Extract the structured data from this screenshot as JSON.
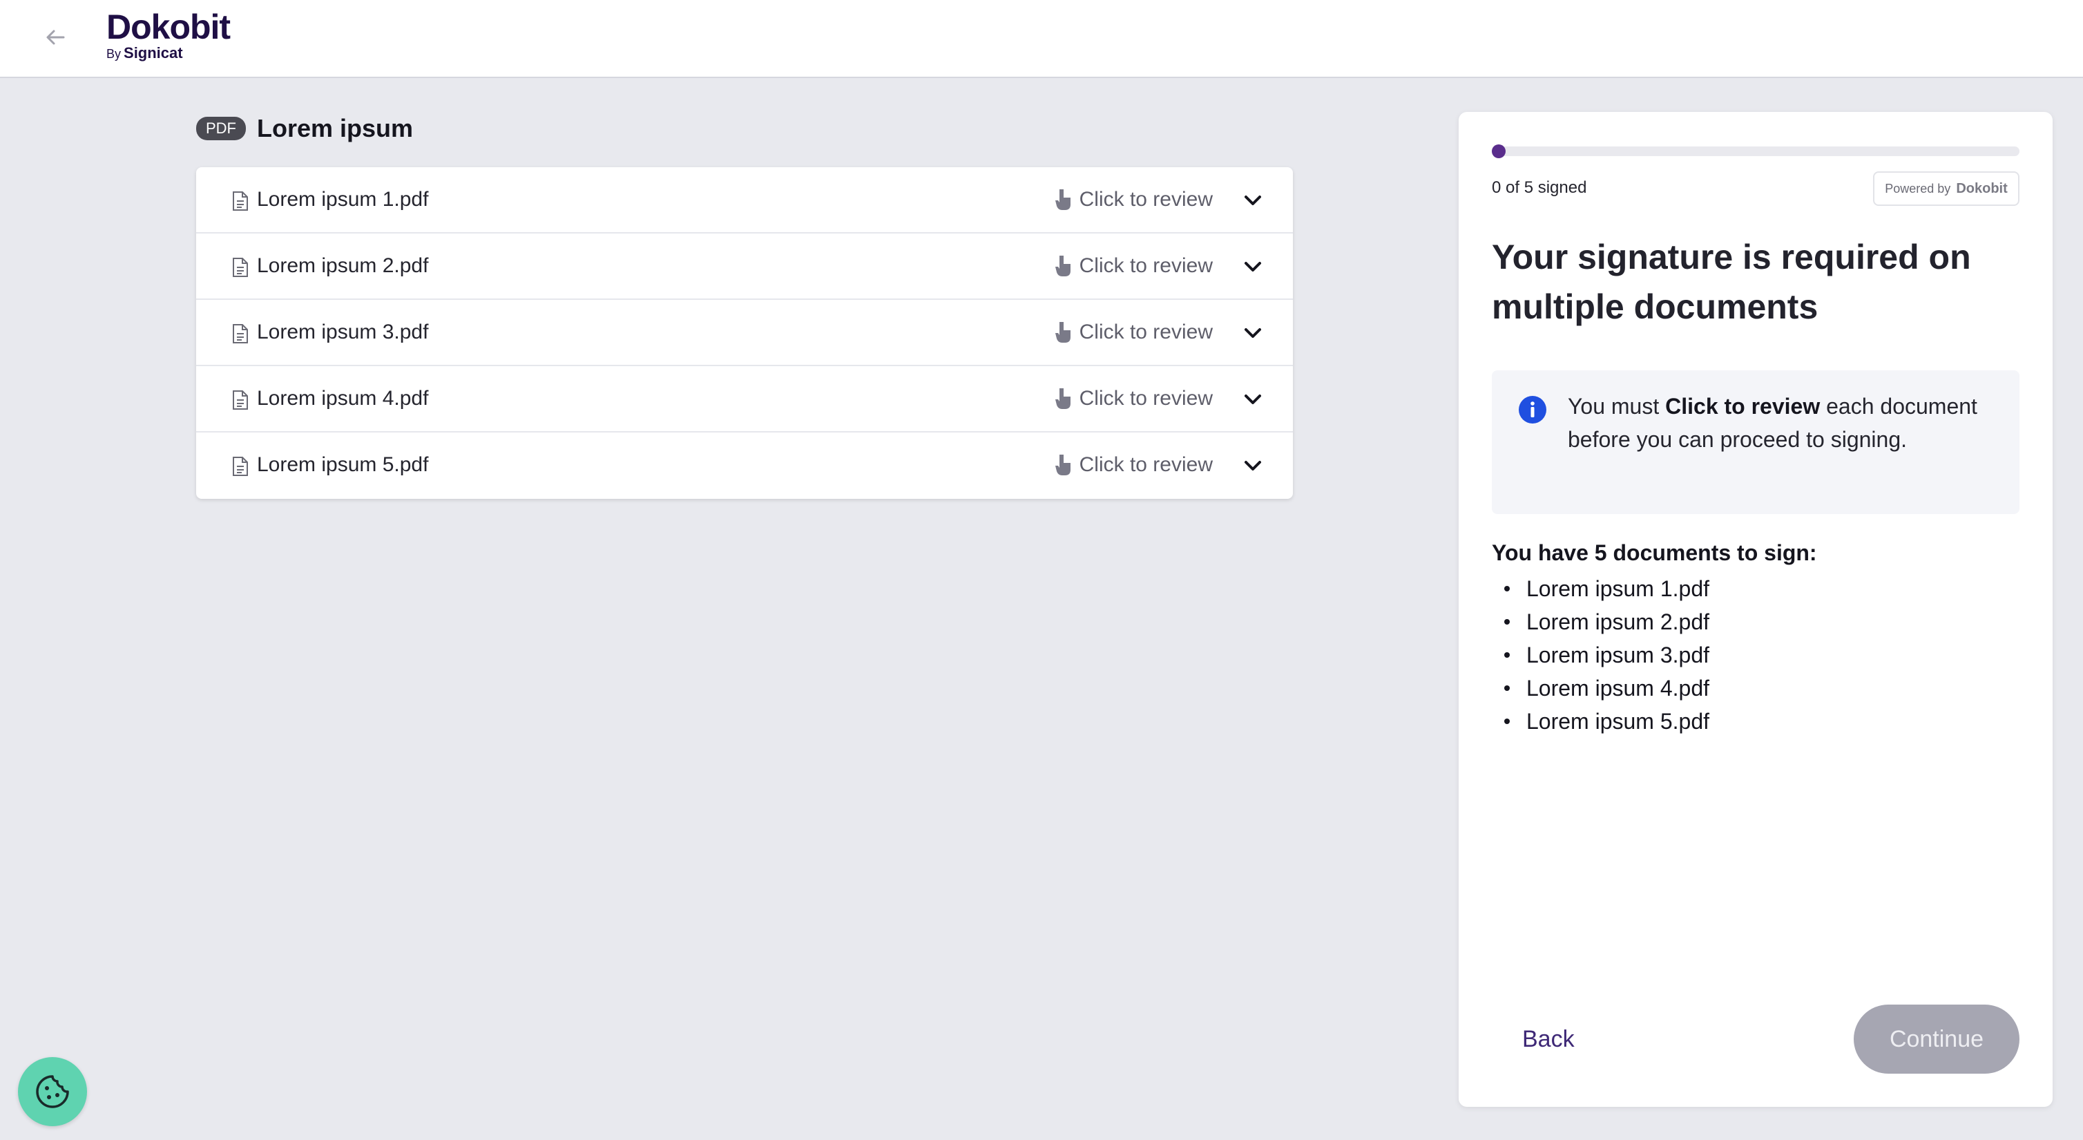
{
  "header": {
    "logo_name": "Dokobit",
    "logo_by": "By",
    "logo_brand": "Signicat"
  },
  "document": {
    "badge": "PDF",
    "title": "Lorem ipsum"
  },
  "files": [
    {
      "name": "Lorem ipsum 1.pdf",
      "review_label": "Click to review"
    },
    {
      "name": "Lorem ipsum 2.pdf",
      "review_label": "Click to review"
    },
    {
      "name": "Lorem ipsum 3.pdf",
      "review_label": "Click to review"
    },
    {
      "name": "Lorem ipsum 4.pdf",
      "review_label": "Click to review"
    },
    {
      "name": "Lorem ipsum 5.pdf",
      "review_label": "Click to review"
    }
  ],
  "panel": {
    "progress": {
      "signed": 0,
      "total": 5,
      "label": "0 of 5 signed"
    },
    "powered_by": "Powered by",
    "powered_brand": "Dokobit",
    "heading": "Your signature is required on multiple documents",
    "info": {
      "text_before": "You must ",
      "text_strong": "Click to review",
      "text_after": " each document before you can proceed to signing."
    },
    "docs_heading": "You have 5 documents to sign:",
    "docs": [
      "Lorem ipsum 1.pdf",
      "Lorem ipsum 2.pdf",
      "Lorem ipsum 3.pdf",
      "Lorem ipsum 4.pdf",
      "Lorem ipsum 5.pdf"
    ],
    "back_label": "Back",
    "continue_label": "Continue"
  },
  "colors": {
    "accent": "#5a2d8c",
    "brand_dark": "#1f0f45",
    "cookie": "#5fd3b0",
    "info_icon": "#1f4fe0"
  }
}
